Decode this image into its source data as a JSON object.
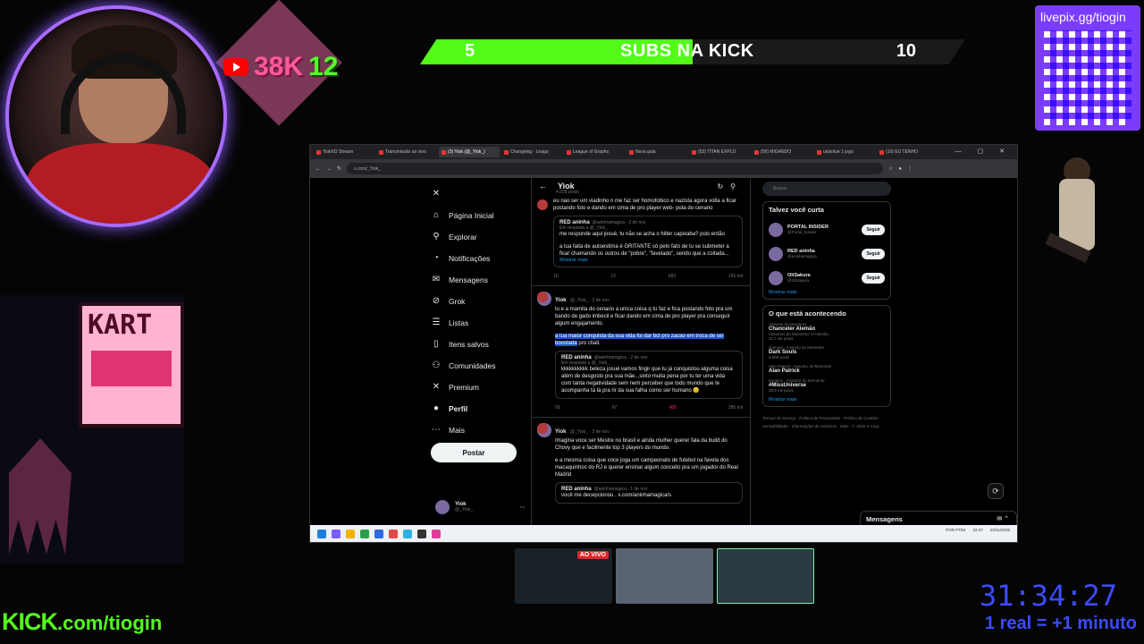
{
  "overlay": {
    "stat_left": "38K",
    "stat_right": "12",
    "subs_left": "5",
    "subs_label": "SUBS NA KICK",
    "subs_right": "10",
    "subs_progress": 0.5,
    "qr_title": "livepix.gg/tiogin",
    "kart_text": "KART",
    "kick_url_main": "KICK",
    "kick_url_rest": ".com/tiogin",
    "timer": "31:34:27",
    "rate": "1 real = +1 minuto",
    "live_tag": "AO VIVO",
    "colors": {
      "kick_green": "#53fc18",
      "timer_blue": "#3c4bff",
      "qr_purple": "#7a3cff"
    }
  },
  "browser": {
    "tabs": [
      "YiokXD Stream",
      "Transmissão ao vivo",
      "(3) Yiok (@_Yiok_)",
      "Changelog - Leagu",
      "League of Graphs",
      "Nova guia",
      "(53) TITAN EXPLO",
      "(56) MIGANDO",
      "unisolue 1 jogo",
      "(10) EU TENHO"
    ],
    "active_tab": 2,
    "address": "x.com/_Yiok_"
  },
  "nav": {
    "items": [
      {
        "label": "Página Inicial",
        "icon": "home-icon",
        "glyph": "⌂"
      },
      {
        "label": "Explorar",
        "icon": "search-icon",
        "glyph": "⚲"
      },
      {
        "label": "Notificações",
        "icon": "bell-icon",
        "glyph": "◔"
      },
      {
        "label": "Mensagens",
        "icon": "mail-icon",
        "glyph": "✉"
      },
      {
        "label": "Grok",
        "icon": "grok-icon",
        "glyph": "⊘"
      },
      {
        "label": "Listas",
        "icon": "list-icon",
        "glyph": "☰"
      },
      {
        "label": "Itens salvos",
        "icon": "bookmark-icon",
        "glyph": "▯"
      },
      {
        "label": "Comunidades",
        "icon": "people-icon",
        "glyph": "⚇"
      },
      {
        "label": "Premium",
        "icon": "x-logo-icon",
        "glyph": "✕"
      },
      {
        "label": "Perfil",
        "icon": "profile-icon",
        "glyph": "●"
      },
      {
        "label": "Mais",
        "icon": "more-icon",
        "glyph": "⋯"
      }
    ],
    "post_label": "Postar",
    "me_name": "Yiok",
    "me_handle": "@_Yiok_"
  },
  "main": {
    "title": "Yiok",
    "subtitle": "4.028 posts",
    "tweet1": {
      "text": "eu nao ser um viadinho n me faz ser homofobico e nazista agora volta a ficar postando foto e dando em cima de pro player web- puta do cenario",
      "quote_name": "RED aninha",
      "quote_handle": "@aninhamagica · 2 de nov",
      "quote_reply": "Em resposta a @_Yiok_",
      "quote_text": "me responde aqui josué, tu não se acha o hitler capixaba? pois então",
      "quote_text2": "a tua falta de autoestima é GRITANTE só pelo fato de tu se submeter a ficar chamando os outros de \"pobre\", \"favelado\", sendo que a coitada...",
      "more": "Mostrar mais",
      "actions": [
        "10",
        "12",
        "683",
        "165 mil"
      ]
    },
    "tweet2": {
      "name": "Yiok",
      "meta": "@_Yiok_ · 2 de nov",
      "text": "tu e a mamita do cenario a unica coisa q tu faz e fica postando foto pra um bando de gado imbecil e ficar dando em cima de pro player pra conseguir algum engajamento.",
      "highlight": "a tua maior conquista da sua vida foi dar  bct pro zacao em troca de ser boostada",
      "tail": "pro chall.",
      "quote_name": "RED aninha",
      "quote_handle": "@aninhamagica · 2 de nov",
      "quote_reply": "Em resposta a @_Yiok_",
      "quote_text": "kkkkkkkkkk beleza josué vamos fingir que tu já conquistou alguma coisa além de desgosto pra sua mãe...sinto muita pena por tu ter uma vida com tanta negatividade sem nem perceber que todo mundo que te acompanha tá lá pra rir da sua falha como ser humano 😊",
      "actions": [
        "69",
        "67",
        "488",
        "285 mil"
      ]
    },
    "tweet3": {
      "name": "Yiok",
      "meta": "@_Yiok_ · 2 de nov",
      "text": "Imagina voce ser Mestre no brasil e ainda mulher querer fala da build do Chovy que e facilmente top 3 players do mundo.",
      "text2": "e a mesma coisa que voce joga um campeonato de futebol na favela dos macaquinhos do RJ e querer ensinar algum conceito pra um jogador do Real Madrid",
      "quote_name": "RED aninha",
      "quote_handle": "@aninhamagica · 1 de nov",
      "quote_text": "você me decepcionou . x.com/aninhamagica/s"
    }
  },
  "right": {
    "search_placeholder": "Buscar",
    "suggest_title": "Talvez você curta",
    "suggestions": [
      {
        "name": "PORTAL INSIDER",
        "handle": "@Portal_Insider",
        "btn": "Seguir"
      },
      {
        "name": "RED aninha",
        "handle": "@aninhamagica",
        "btn": "Seguir"
      },
      {
        "name": "OliSakura",
        "handle": "@OliSakura",
        "btn": "Seguir"
      }
    ],
    "show_more": "Mostrar mais",
    "trending_title": "O que está acontecendo",
    "trends": [
      {
        "ctx": "Assunto do Momento",
        "title": "Chanceler Alemão",
        "sub": "Assuntos do Momento: O Alemão",
        "count": "11,7 mil posts"
      },
      {
        "ctx": "Gaming · Assunto do Momento",
        "title": "Dark Souls",
        "count": "6.609 posts"
      },
      {
        "ctx": "Alan Patrick · Assunto do Momento",
        "title": "Alan Patrick",
        "count": ""
      },
      {
        "ctx": "Eventos · Assunto do Momento",
        "title": "#MissUniverse",
        "count": "38,8 mil posts"
      }
    ],
    "show_more2": "Mostrar mais",
    "footer": "Termos de Serviço · Política de Privacidade · Política de Cookies · Acessibilidade · Informações de anúncios · Mais · © 2025 X Corp.",
    "messages": "Mensagens"
  },
  "taskbar": {
    "tray_lang": "POR PTB2",
    "tray_time": "22:47",
    "tray_date": "20/11/2025"
  }
}
